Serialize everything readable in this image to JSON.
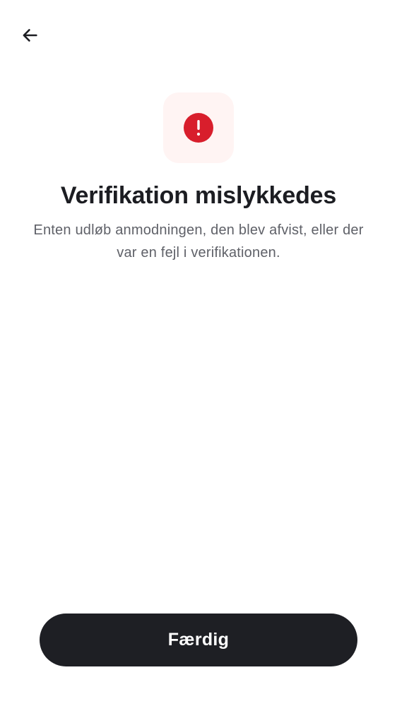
{
  "header": {
    "back_icon": "arrow-left-icon"
  },
  "status": {
    "icon": "exclamation-circle-icon",
    "icon_color": "#d81e2c",
    "tile_color": "#fff4f3"
  },
  "content": {
    "title": "Verifikation mislykkedes",
    "description": "Enten udløb anmodningen, den blev afvist, eller der var en fejl i verifikationen."
  },
  "footer": {
    "done_label": "Færdig",
    "button_color": "#1e1f24"
  }
}
